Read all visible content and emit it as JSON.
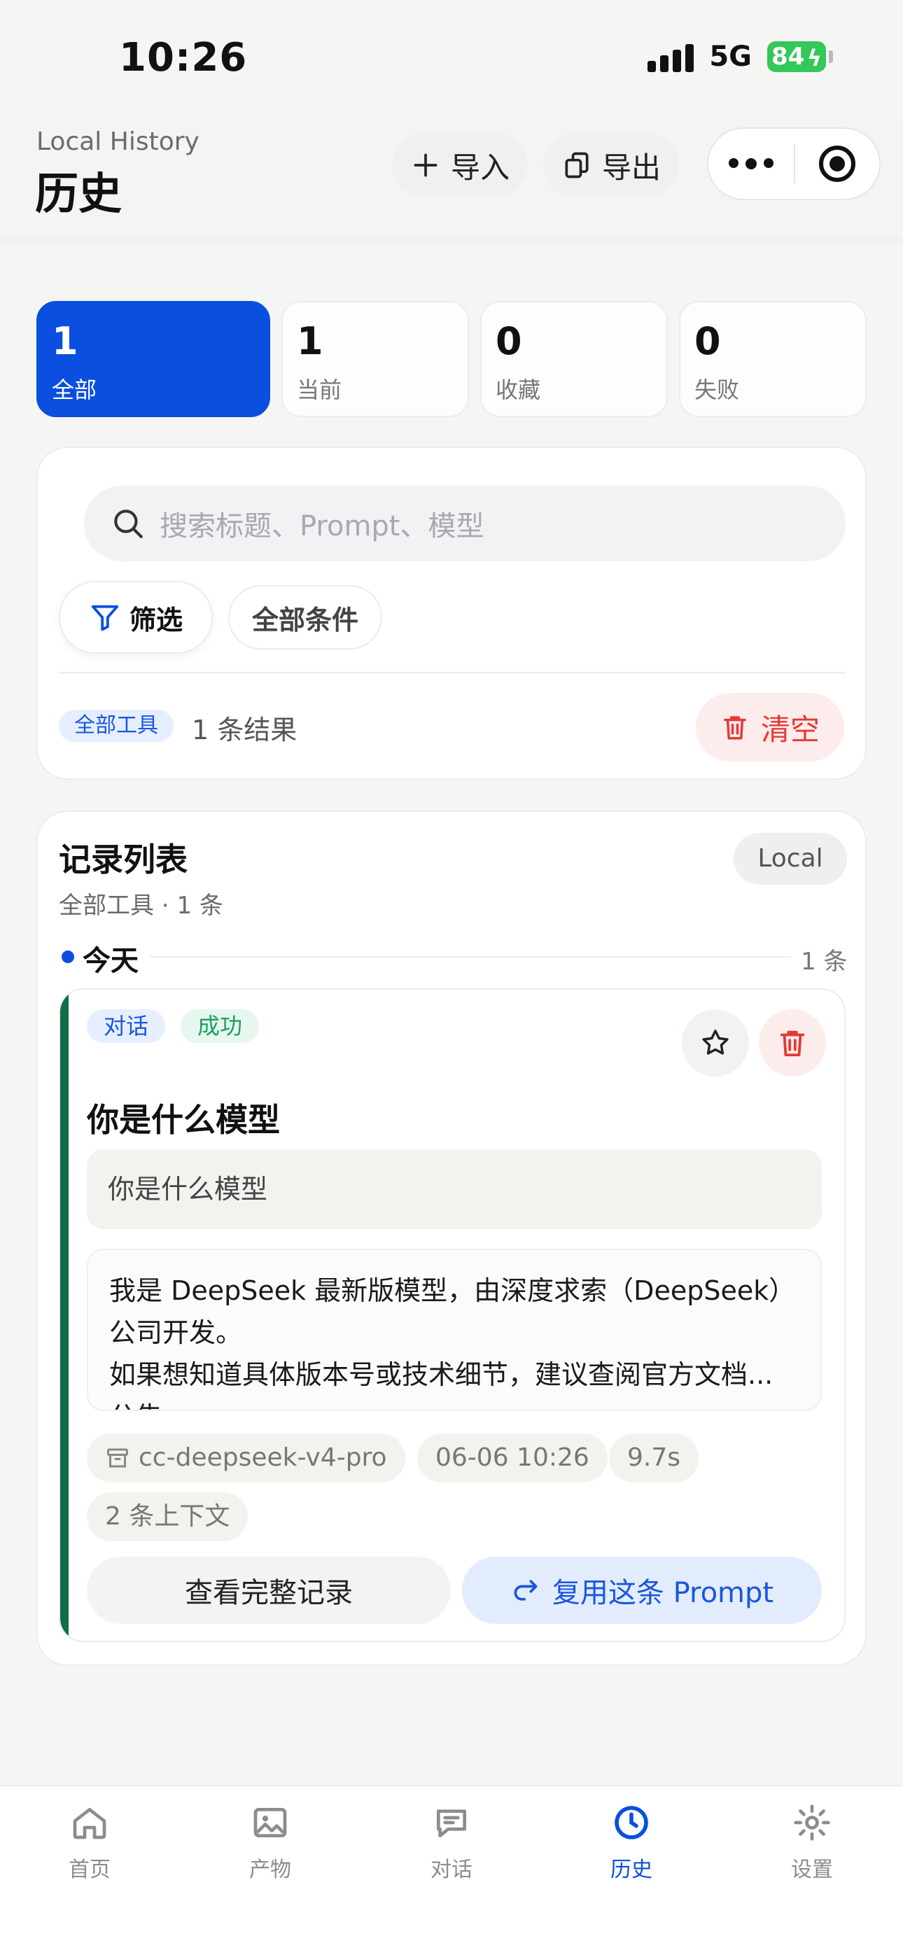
{
  "status_bar": {
    "time": "10:26",
    "network": "5G",
    "battery": "84"
  },
  "header": {
    "subtitle": "Local History",
    "title": "历史",
    "import_label": "导入",
    "export_label": "导出"
  },
  "stats": [
    {
      "value": "1",
      "label": "全部",
      "active": true
    },
    {
      "value": "1",
      "label": "当前",
      "active": false
    },
    {
      "value": "0",
      "label": "收藏",
      "active": false
    },
    {
      "value": "0",
      "label": "失败",
      "active": false
    }
  ],
  "filter": {
    "search_placeholder": "搜索标题、Prompt、模型",
    "filter_label": "筛选",
    "all_conditions_label": "全部条件",
    "tool_badge": "全部工具",
    "result_count": "1 条结果",
    "clear_label": "清空"
  },
  "list": {
    "title": "记录列表",
    "subtitle": "全部工具 · 1 条",
    "badge": "Local",
    "day_label": "今天",
    "day_count": "1 条",
    "record": {
      "tag_type": "对话",
      "tag_status": "成功",
      "title": "你是什么模型",
      "prompt": "你是什么模型",
      "answer_lines": [
        "我是 DeepSeek 最新版模型，由深度求索（DeepSeek）",
        "公司开发。",
        "如果想知道具体版本号或技术细节，建议查阅官方文档...",
        "公告。"
      ],
      "model": "cc-deepseek-v4-pro",
      "time": "06-06 10:26",
      "duration": "9.7s",
      "context": "2 条上下文",
      "view_label": "查看完整记录",
      "reuse_label": "复用这条 Prompt"
    }
  },
  "tabbar": {
    "tabs": [
      {
        "label": "首页",
        "icon": "home-icon"
      },
      {
        "label": "产物",
        "icon": "image-icon"
      },
      {
        "label": "对话",
        "icon": "chat-icon"
      },
      {
        "label": "历史",
        "icon": "clock-icon",
        "active": true
      },
      {
        "label": "设置",
        "icon": "gear-icon"
      }
    ]
  },
  "colors": {
    "accent": "#0a4fe0",
    "danger": "#e53935",
    "success": "#1aa15e",
    "record_accent": "#0f6e46"
  }
}
